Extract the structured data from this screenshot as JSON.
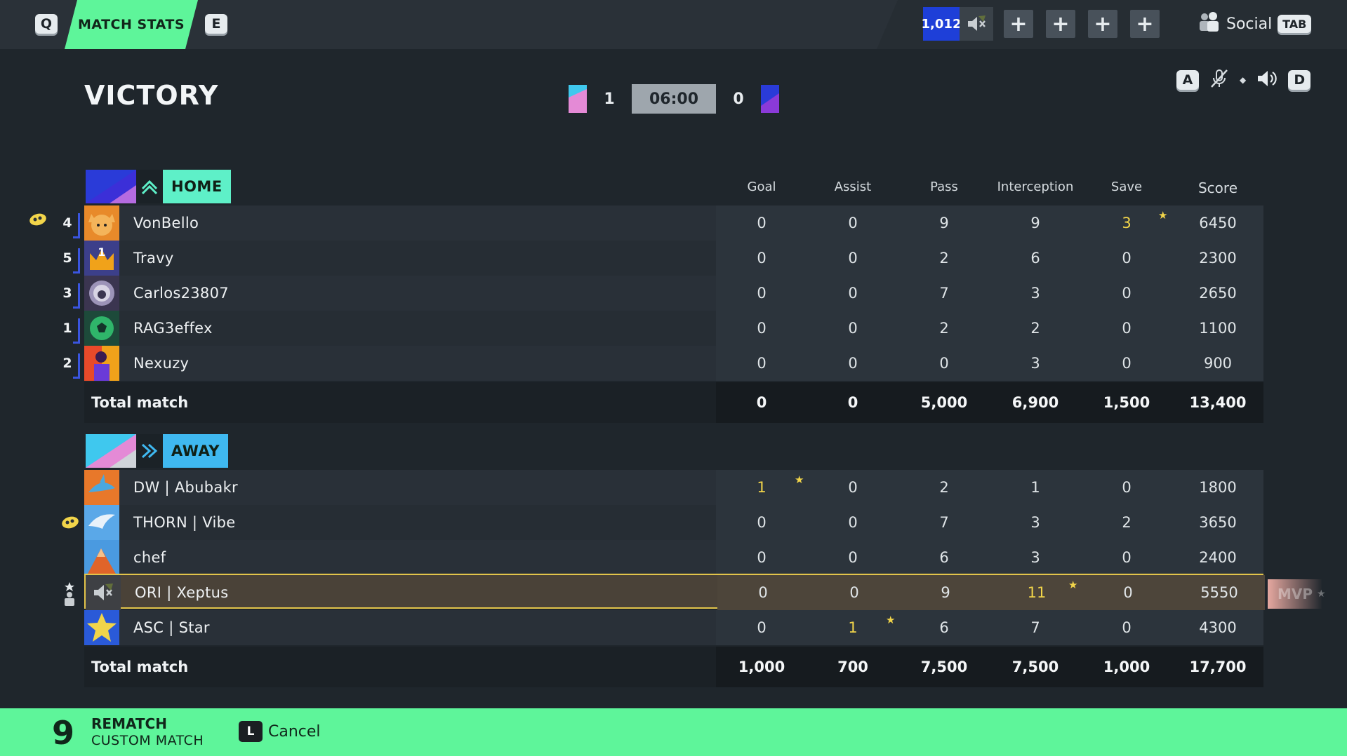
{
  "topbar": {
    "prev_key": "Q",
    "next_key": "E",
    "active_tab": "MATCH STATS",
    "currency_amount": "1,012",
    "plus_buttons": [
      "+",
      "+",
      "+",
      "+"
    ],
    "social_label": "Social",
    "social_key": "TAB"
  },
  "header": {
    "result": "VICTORY",
    "home_score": "1",
    "timer": "06:00",
    "away_score": "0",
    "audio_left_key": "A",
    "audio_right_key": "D"
  },
  "columns": [
    "Goal",
    "Assist",
    "Pass",
    "Interception",
    "Save",
    "Score"
  ],
  "home": {
    "label": "HOME",
    "color": "#5ef0c8",
    "players": [
      {
        "rank": "4",
        "name": "VonBello",
        "goal": "0",
        "assist": "0",
        "pass": "9",
        "interception": "9",
        "save": "3",
        "score": "6450"
      },
      {
        "rank": "5",
        "name": "Travy",
        "goal": "0",
        "assist": "0",
        "pass": "2",
        "interception": "6",
        "save": "0",
        "score": "2300"
      },
      {
        "rank": "3",
        "name": "Carlos23807",
        "goal": "0",
        "assist": "0",
        "pass": "7",
        "interception": "3",
        "save": "0",
        "score": "2650"
      },
      {
        "rank": "1",
        "name": "RAG3effex",
        "goal": "0",
        "assist": "0",
        "pass": "2",
        "interception": "2",
        "save": "0",
        "score": "1100"
      },
      {
        "rank": "2",
        "name": "Nexuzy",
        "goal": "0",
        "assist": "0",
        "pass": "0",
        "interception": "3",
        "save": "0",
        "score": "900"
      }
    ],
    "total": {
      "label": "Total match",
      "goal": "0",
      "assist": "0",
      "pass": "5,000",
      "interception": "6,900",
      "save": "1,500",
      "score": "13,400"
    }
  },
  "away": {
    "label": "AWAY",
    "color": "#3fb8f0",
    "players": [
      {
        "name": "DW | Abubakr",
        "goal": "1",
        "assist": "0",
        "pass": "2",
        "interception": "1",
        "save": "0",
        "score": "1800"
      },
      {
        "name": "THORN | Vibe",
        "goal": "0",
        "assist": "0",
        "pass": "7",
        "interception": "3",
        "save": "2",
        "score": "3650"
      },
      {
        "name": "chef",
        "goal": "0",
        "assist": "0",
        "pass": "6",
        "interception": "3",
        "save": "0",
        "score": "2400"
      },
      {
        "name": "ORI | Xeptus",
        "goal": "0",
        "assist": "0",
        "pass": "9",
        "interception": "11",
        "save": "0",
        "score": "5550"
      },
      {
        "name": "ASC | Star",
        "goal": "0",
        "assist": "1",
        "pass": "6",
        "interception": "7",
        "save": "0",
        "score": "4300"
      }
    ],
    "total": {
      "label": "Total match",
      "goal": "1,000",
      "assist": "700",
      "pass": "7,500",
      "interception": "7,500",
      "save": "1,000",
      "score": "17,700"
    }
  },
  "mvp_label": "MVP",
  "bottom": {
    "countdown": "9",
    "rematch": "REMATCH",
    "mode": "CUSTOM MATCH",
    "cancel_key": "L",
    "cancel_label": "Cancel"
  }
}
